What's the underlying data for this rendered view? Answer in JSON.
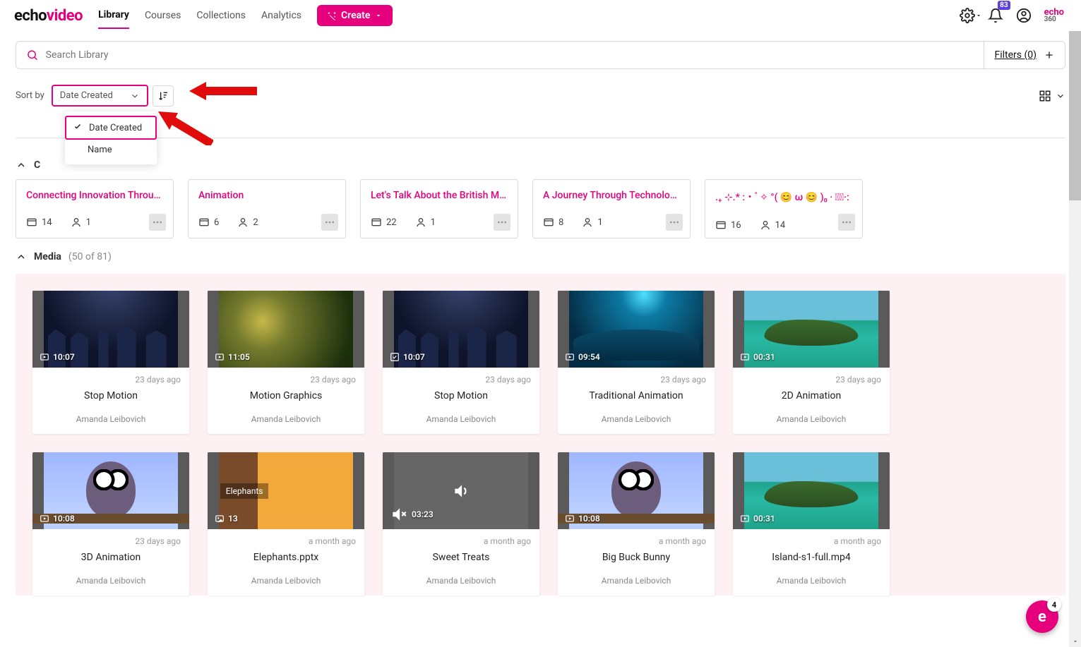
{
  "brand": {
    "left": "echo",
    "right": "video"
  },
  "nav": {
    "tabs": [
      "Library",
      "Courses",
      "Collections",
      "Analytics"
    ],
    "active_index": 0,
    "create_label": "Create",
    "notifications_badge": "83",
    "echo360_top": "echo",
    "echo360_bottom": "360"
  },
  "search": {
    "placeholder": "Search Library",
    "filters_label": "Filters (0)"
  },
  "sort": {
    "label": "Sort by",
    "selected": "Date Created",
    "options": [
      {
        "label": "Date Created",
        "selected": true
      },
      {
        "label": "Name",
        "selected": false
      }
    ]
  },
  "collections_section": {
    "toggle_open": true,
    "title_prefix": "C",
    "cards": [
      {
        "title": "Connecting Innovation Throug…",
        "media_count": "14",
        "user_count": "1"
      },
      {
        "title": "Animation",
        "media_count": "6",
        "user_count": "2"
      },
      {
        "title": "Let's Talk About the British Mo…",
        "media_count": "22",
        "user_count": "1"
      },
      {
        "title": "A Journey Through Technology",
        "media_count": "8",
        "user_count": "1"
      },
      {
        "title": ".₊ ⊹.* :・ﾟ✧ °( 😊 ω 😊 )₀ · ┊͙·:",
        "media_count": "16",
        "user_count": "14"
      }
    ]
  },
  "media_section": {
    "title": "Media",
    "count_label": "(50 of 81)",
    "cards": [
      {
        "duration": "10:07",
        "date": "23 days ago",
        "title": "Stop Motion",
        "author": "Amanda Leibovich",
        "scene": "night",
        "icon": "play"
      },
      {
        "duration": "11:05",
        "date": "23 days ago",
        "title": "Motion Graphics",
        "author": "Amanda Leibovich",
        "scene": "green",
        "icon": "play"
      },
      {
        "duration": "10:07",
        "date": "23 days ago",
        "title": "Stop Motion",
        "author": "Amanda Leibovich",
        "scene": "night",
        "icon": "check"
      },
      {
        "duration": "09:54",
        "date": "23 days ago",
        "title": "Traditional Animation",
        "author": "Amanda Leibovich",
        "scene": "under",
        "icon": "play"
      },
      {
        "duration": "00:31",
        "date": "23 days ago",
        "title": "2D Animation",
        "author": "Amanda Leibovich",
        "scene": "island",
        "icon": "play"
      },
      {
        "duration": "10:08",
        "date": "23 days ago",
        "title": "3D Animation",
        "author": "Amanda Leibovich",
        "scene": "owl",
        "icon": "play"
      },
      {
        "duration": "13",
        "date": "a month ago",
        "title": "Elephants.pptx",
        "author": "Amanda Leibovich",
        "scene": "elephants",
        "icon": "image",
        "inner_label": "Elephants"
      },
      {
        "duration": "03:23",
        "date": "a month ago",
        "title": "Sweet Treats",
        "author": "Amanda Leibovich",
        "scene": "audio",
        "icon": "mute"
      },
      {
        "duration": "10:08",
        "date": "a month ago",
        "title": "Big Buck Bunny",
        "author": "Amanda Leibovich",
        "scene": "owl",
        "icon": "play"
      },
      {
        "duration": "00:31",
        "date": "a month ago",
        "title": "Island-s1-full.mp4",
        "author": "Amanda Leibovich",
        "scene": "island",
        "icon": "play"
      }
    ]
  },
  "fab": {
    "glyph": "e",
    "badge": "4"
  }
}
